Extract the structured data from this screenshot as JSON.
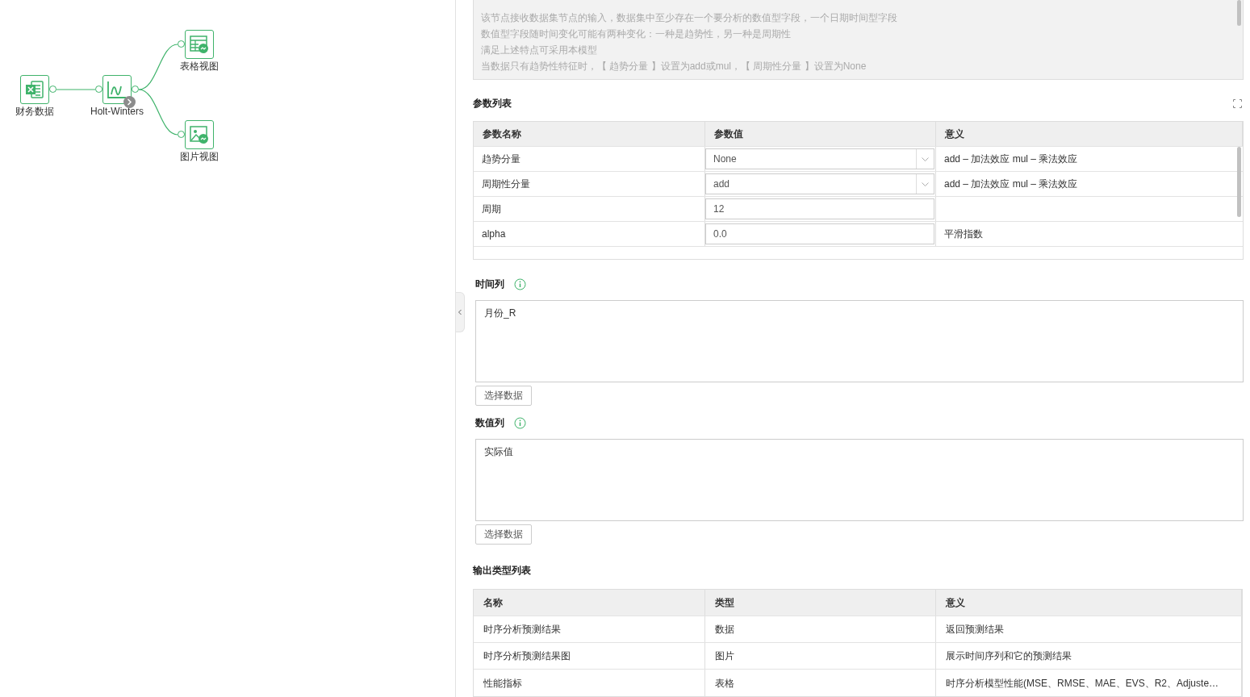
{
  "flow": {
    "nodes": [
      {
        "label": "财务数据",
        "kind": "excel"
      },
      {
        "label": "Holt-Winters",
        "kind": "chart",
        "has_run_badge": true
      },
      {
        "label": "表格视图",
        "kind": "table"
      },
      {
        "label": "图片视图",
        "kind": "image"
      }
    ]
  },
  "description": {
    "lines": [
      "该节点接收数据集节点的输入，数据集中至少存在一个要分析的数值型字段，一个日期时间型字段",
      "数值型字段随时间变化可能有两种变化：一种是趋势性，另一种是周期性",
      "满足上述特点可采用本模型",
      "当数据只有趋势性特征时，【 趋势分量 】设置为add或mul，【 周期性分量 】设置为None"
    ]
  },
  "params": {
    "title": "参数列表",
    "columns": [
      "参数名称",
      "参数值",
      "意义"
    ],
    "rows": [
      {
        "name": "趋势分量",
        "kind": "select",
        "value": "None",
        "meaning": "add – 加法效应 mul – 乘法效应"
      },
      {
        "name": "周期性分量",
        "kind": "select",
        "value": "add",
        "meaning": "add – 加法效应 mul – 乘法效应"
      },
      {
        "name": "周期",
        "kind": "input",
        "value": "12"
      },
      {
        "name": "alpha",
        "kind": "input",
        "value": "0.0",
        "meaning": "平滑指数"
      }
    ]
  },
  "fields": [
    {
      "label": "时间列",
      "value": "月份_R",
      "button": "选择数据"
    },
    {
      "label": "数值列",
      "value": "实际值",
      "button": "选择数据"
    }
  ],
  "outputs": {
    "title": "输出类型列表",
    "columns": [
      "名称",
      "类型",
      "意义"
    ],
    "rows": [
      {
        "name": "时序分析预测结果",
        "type": "数据",
        "meaning": "返回预测结果"
      },
      {
        "name": "时序分析预测结果图",
        "type": "图片",
        "meaning": "展示时间序列和它的预测结果"
      },
      {
        "name": "性能指标",
        "type": "表格",
        "meaning": "时序分析模型性能(MSE、RMSE、MAE、EVS、R2、Adjuste…"
      }
    ]
  }
}
